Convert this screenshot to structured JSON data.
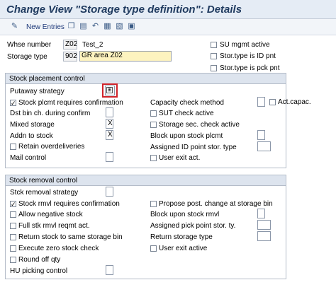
{
  "title": "Change View \"Storage type definition\": Details",
  "toolbar": {
    "new_entries": "New Entries"
  },
  "header": {
    "whse_label": "Whse number",
    "whse_value": "Z02",
    "whse_desc": "Test_2",
    "stype_label": "Storage type",
    "stype_value": "902",
    "stype_desc": "GR area Z02",
    "su_mgmt": "SU mgmt active",
    "is_id_pnt": "Stor.type is ID pnt",
    "is_pck_pnt": "Stor.type is pck pnt"
  },
  "placement": {
    "heading": "Stock placement control",
    "putaway": "Putaway strategy",
    "stock_plcmt_conf": "Stock plcmt requires confirmation",
    "dst_bin": "Dst bin ch. during confirm",
    "mixed": "Mixed storage",
    "mixed_value": "X",
    "addn": "Addn to stock",
    "addn_value": "X",
    "retain": "Retain overdeliveries",
    "mail": "Mail control",
    "capacity": "Capacity check method",
    "act_capac": "Act.capac.",
    "sut": "SUT check active",
    "storage_sec": "Storage sec. check active",
    "block": "Block upon stock plcmt",
    "assigned_id": "Assigned ID point stor. type",
    "user_exit": "User exit act."
  },
  "removal": {
    "heading": "Stock removal control",
    "strategy": "Stck removal strategy",
    "rmvl_conf": "Stock rmvl requires confirmation",
    "neg": "Allow negative stock",
    "full": "Full stk rmvl reqmt act.",
    "return_same": "Return stock to same storage bin",
    "zero": "Execute zero stock check",
    "round": "Round off qty",
    "hu": "HU picking control",
    "propose": "Propose post. change at storage bin",
    "block": "Block upon stock rmvl",
    "assigned_pick": "Assigned pick point stor. ty.",
    "return_type": "Return storage type",
    "user_exit": "User exit active"
  }
}
